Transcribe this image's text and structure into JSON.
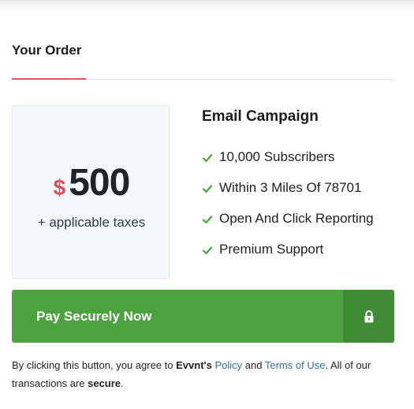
{
  "order": {
    "title": "Your Order"
  },
  "price": {
    "currency_symbol": "$",
    "amount": "500",
    "taxes_note": "+ applicable taxes"
  },
  "product": {
    "title": "Email Campaign",
    "features": [
      {
        "label": "10,000 Subscribers",
        "icon": "check-icon"
      },
      {
        "label": "Within 3 Miles Of 78701",
        "icon": "check-icon"
      },
      {
        "label": "Open And Click Reporting",
        "icon": "check-icon"
      },
      {
        "label": "Premium Support",
        "icon": "check-icon"
      }
    ]
  },
  "pay_button": {
    "label": "Pay Securely Now",
    "icon": "lock-icon"
  },
  "terms": {
    "text_1": "By clicking this button, you agree to ",
    "brand": "Evvnt's",
    "space_1": " ",
    "policy_link": "Policy",
    "text_2": " and ",
    "terms_link": "Terms of Use",
    "text_3": ". All of our transactions are ",
    "secure": "secure",
    "text_4": "."
  },
  "colors": {
    "accent_red": "#e34a56",
    "button_green": "#4aa33d",
    "button_green_dark": "#3f8c34",
    "check_green": "#4aa33d",
    "link_blue": "#2f6fa8",
    "price_box_bg": "#f3f8fb"
  }
}
